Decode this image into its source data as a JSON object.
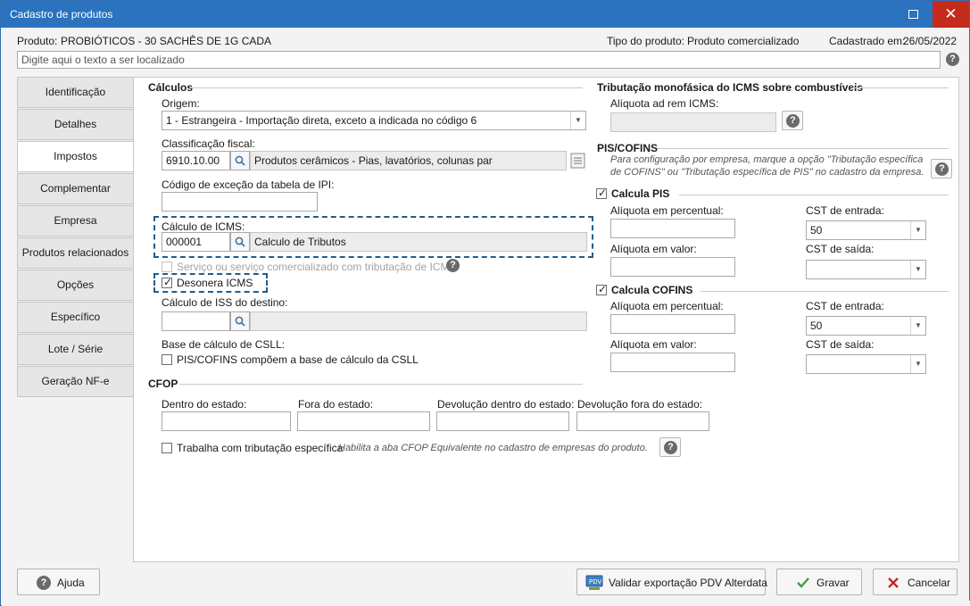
{
  "window": {
    "title": "Cadastro de produtos"
  },
  "header": {
    "produto_label": "Produto:",
    "produto_value": "PROBIÓTICOS - 30 SACHÊS DE 1G CADA",
    "tipo_label": "Tipo do produto:",
    "tipo_value": "Produto comercializado",
    "cadastrado_label": "Cadastrado em:",
    "cadastrado_value": "26/05/2022",
    "search_placeholder": "Digite aqui o texto a ser localizado"
  },
  "tabs": [
    {
      "label": "Identificação"
    },
    {
      "label": "Detalhes"
    },
    {
      "label": "Impostos"
    },
    {
      "label": "Complementar"
    },
    {
      "label": "Empresa"
    },
    {
      "label": "Produtos relacionados"
    },
    {
      "label": "Opções"
    },
    {
      "label": "Específico"
    },
    {
      "label": "Lote / Série"
    },
    {
      "label": "Geração NF-e"
    }
  ],
  "calculos": {
    "section_title": "Cálculos",
    "origem_label": "Origem:",
    "origem_value": "1 - Estrangeira - Importação direta, exceto a indicada no código 6",
    "classificacao_label": "Classificação fiscal:",
    "classificacao_code": "6910.10.00",
    "classificacao_desc": "Produtos cerâmicos - Pias, lavatórios, colunas par",
    "excecao_label": "Código de exceção da tabela de IPI:",
    "excecao_value": "",
    "icms_label": "Cálculo de ICMS:",
    "icms_code": "000001",
    "icms_desc": "Calculo de Tributos",
    "servico_label": "Serviço ou serviço comercializado com tributação de ICMS",
    "desonera_label": "Desonera ICMS",
    "iss_label": "Cálculo de ISS do destino:",
    "csll_label": "Base de cálculo de CSLL:",
    "csll_check_label": "PIS/COFINS compõem a base de cálculo da CSLL"
  },
  "cfop": {
    "section_title": "CFOP",
    "dentro_label": "Dentro do estado:",
    "fora_label": "Fora do estado:",
    "dev_dentro_label": "Devolução dentro do estado:",
    "dev_fora_label": "Devolução fora do estado:",
    "trib_label": "Trabalha com tributação específica",
    "trib_hint": "Habilita a aba CFOP Equivalente no cadastro de empresas do produto."
  },
  "monofasica": {
    "section_title": "Tributação monofásica do ICMS sobre combustíveis",
    "aliquota_label": "Alíquota ad rem ICMS:"
  },
  "piscofins": {
    "section_title": "PIS/COFINS",
    "hint_line1": "Para configuração por empresa, marque a opção \"Tributação específica",
    "hint_line2": "de COFINS\" ou \"Tributação específica de PIS\" no cadastro da empresa.",
    "pis": {
      "check_label": "Calcula PIS",
      "aliq_perc_label": "Alíquota em percentual:",
      "cst_entrada_label": "CST de entrada:",
      "cst_entrada_value": "50",
      "aliq_valor_label": "Alíquota em valor:",
      "cst_saida_label": "CST de saída:"
    },
    "cofins": {
      "check_label": "Calcula COFINS",
      "aliq_perc_label": "Alíquota em percentual:",
      "cst_entrada_label": "CST de entrada:",
      "cst_entrada_value": "50",
      "aliq_valor_label": "Alíquota em valor:",
      "cst_saida_label": "CST de saída:"
    }
  },
  "footer": {
    "ajuda_label": "Ajuda",
    "validar_label": "Validar exportação PDV Alterdata",
    "gravar_label": "Gravar",
    "cancelar_label": "Cancelar"
  },
  "colors": {
    "titlebar": "#2b72bf",
    "close": "#c42b1c",
    "dashed": "#1e5e8e",
    "gravar_check": "#3aa03a",
    "cancel_x": "#c62828"
  }
}
